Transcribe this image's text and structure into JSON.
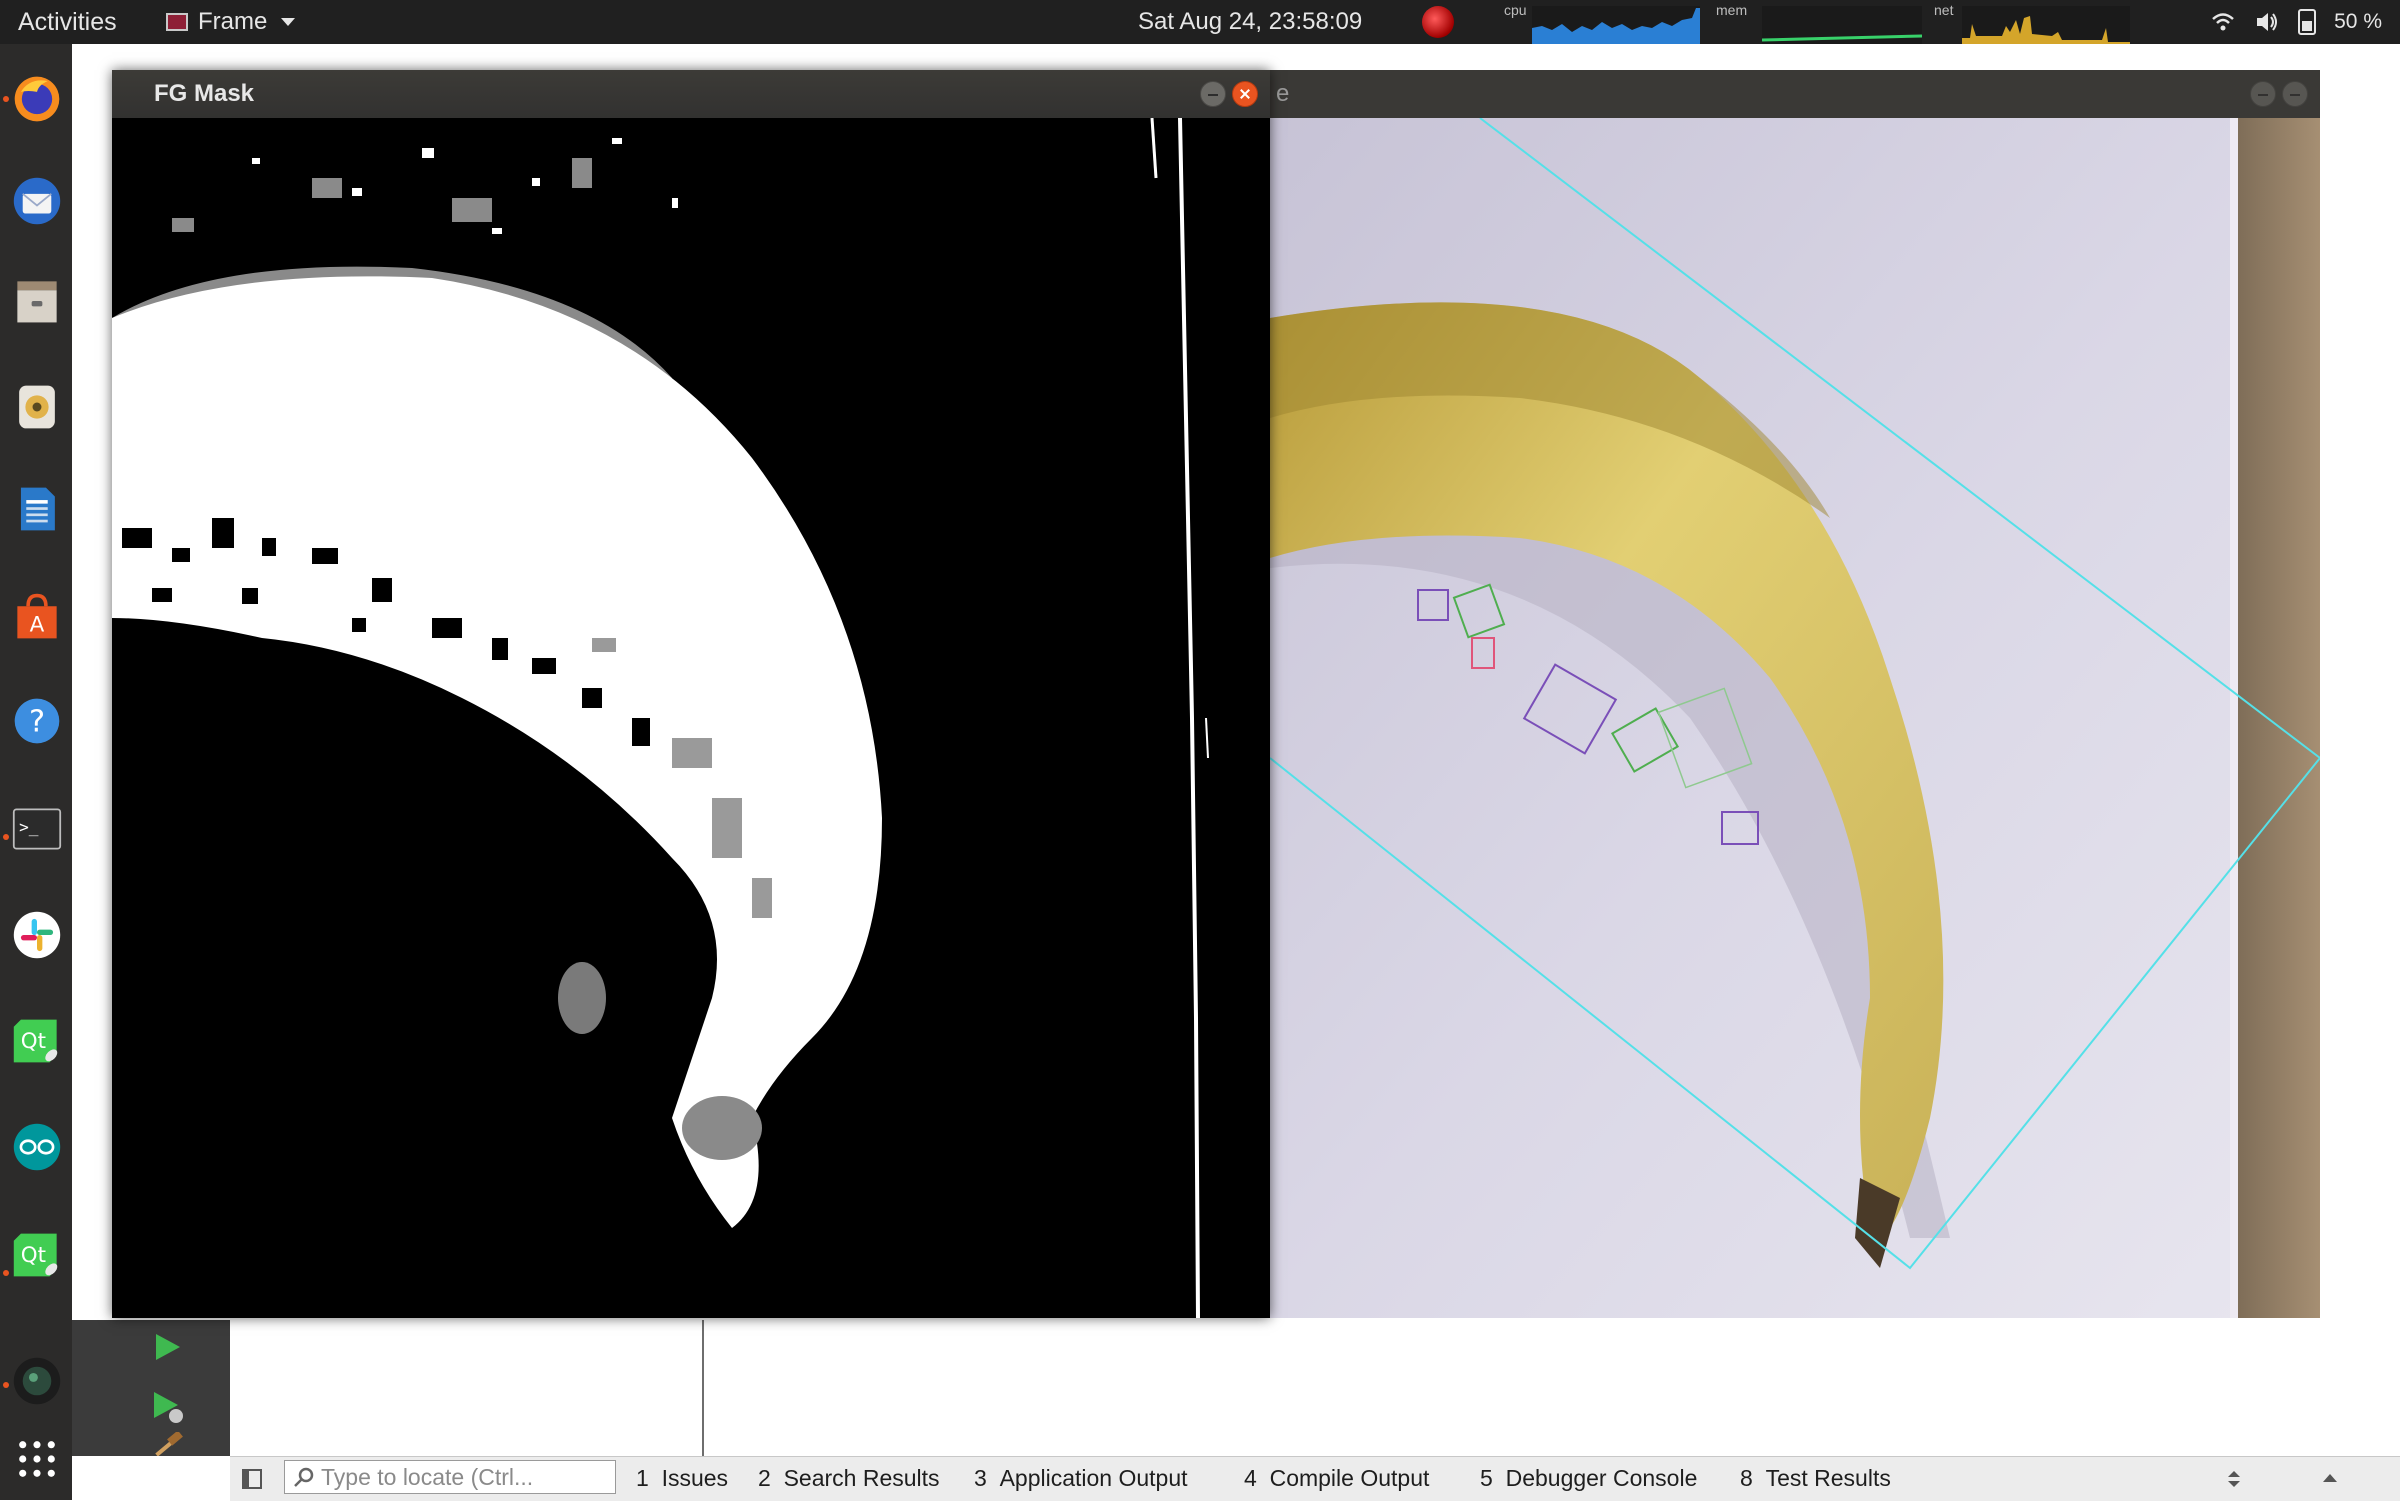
{
  "topbar": {
    "activities": "Activities",
    "app_menu": "Frame",
    "clock": "Sat Aug 24, 23:58:09",
    "monitors": {
      "cpu": "cpu",
      "mem": "mem",
      "net": "net"
    },
    "battery": "50 %"
  },
  "dock": {
    "items": [
      {
        "name": "firefox-icon",
        "running": true
      },
      {
        "name": "thunderbird-icon",
        "running": false
      },
      {
        "name": "files-icon",
        "running": false
      },
      {
        "name": "rhythmbox-icon",
        "running": false
      },
      {
        "name": "writer-icon",
        "running": false
      },
      {
        "name": "software-center-icon",
        "running": false
      },
      {
        "name": "help-icon",
        "running": false
      },
      {
        "name": "terminal-icon",
        "running": true
      },
      {
        "name": "slack-icon",
        "running": false
      },
      {
        "name": "qt-creator-icon",
        "running": false
      },
      {
        "name": "arduino-icon",
        "running": false
      },
      {
        "name": "qt-creator-2-icon",
        "running": true
      },
      {
        "name": "webcam-icon",
        "running": true
      },
      {
        "name": "show-apps-icon",
        "running": false
      }
    ]
  },
  "windows": {
    "fg_mask": {
      "title": "FG Mask"
    },
    "frame": {
      "title_fragment": "e"
    }
  },
  "ide": {
    "locator_placeholder": "Type to locate (Ctrl...",
    "tabs": [
      {
        "num": "1",
        "label": "Issues"
      },
      {
        "num": "2",
        "label": "Search Results"
      },
      {
        "num": "3",
        "label": "Application Output"
      },
      {
        "num": "4",
        "label": "Compile Output"
      },
      {
        "num": "5",
        "label": "Debugger Console"
      },
      {
        "num": "8",
        "label": "Test Results"
      }
    ]
  },
  "colors": {
    "accent": "#e95420",
    "overlay_line": "#55e0e8",
    "box_purple": "#7a4fb8",
    "box_green": "#4fae4f",
    "box_red": "#e0557a"
  }
}
